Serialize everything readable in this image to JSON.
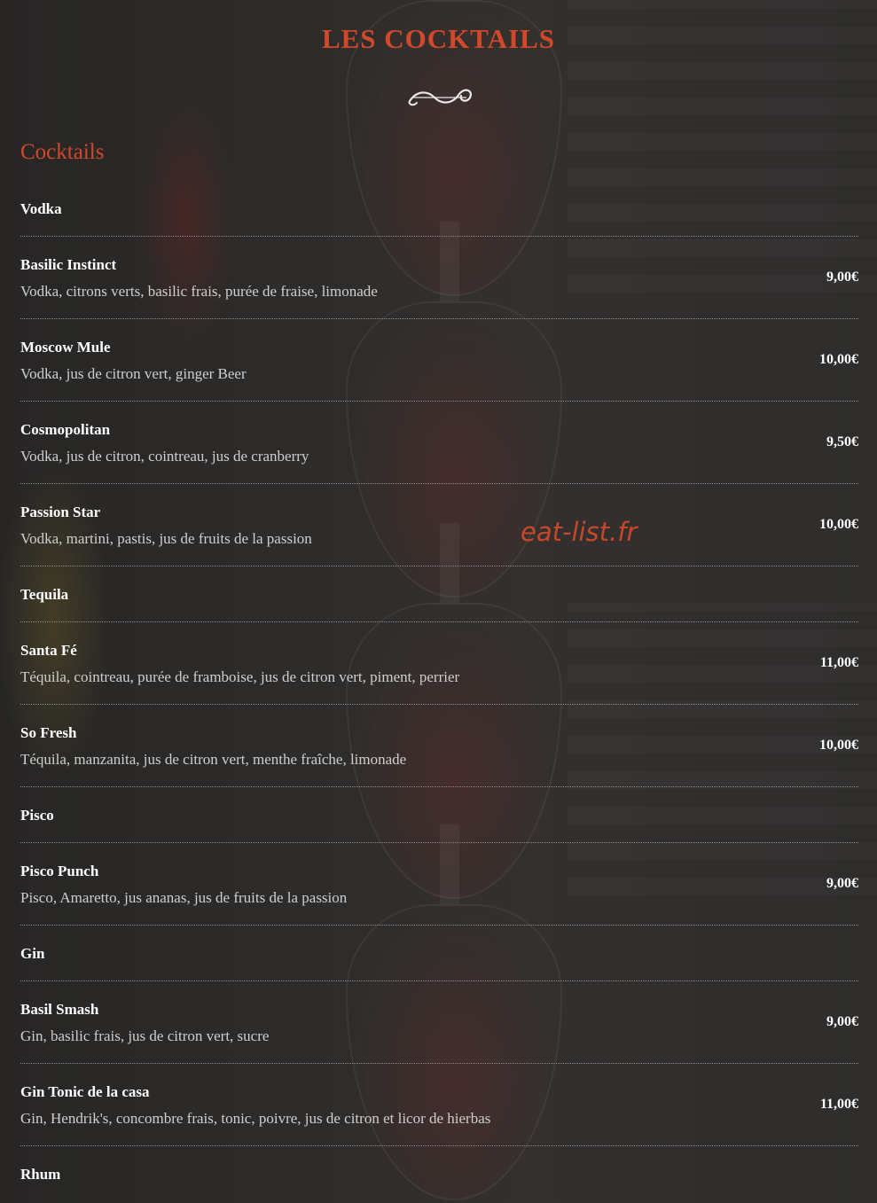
{
  "header": {
    "title": "LES COCKTAILS"
  },
  "section": {
    "title": "Cocktails"
  },
  "menu": [
    {
      "type": "category",
      "name": "Vodka"
    },
    {
      "type": "item",
      "name": "Basilic Instinct",
      "desc": "Vodka, citrons verts, basilic frais, purée de fraise, limonade",
      "price": "9,00€"
    },
    {
      "type": "item",
      "name": "Moscow Mule",
      "desc": "Vodka, jus de citron vert, ginger Beer",
      "price": "10,00€"
    },
    {
      "type": "item",
      "name": "Cosmopolitan",
      "desc": "Vodka, jus de citron, cointreau, jus de cranberry",
      "price": "9,50€"
    },
    {
      "type": "item",
      "name": "Passion Star",
      "desc": "Vodka, martini, pastis, jus de fruits de la passion",
      "price": "10,00€"
    },
    {
      "type": "category",
      "name": "Tequila"
    },
    {
      "type": "item",
      "name": "Santa Fé",
      "desc": "Téquila, cointreau, purée de framboise, jus de citron vert, piment, perrier",
      "price": "11,00€"
    },
    {
      "type": "item",
      "name": "So Fresh",
      "desc": "Téquila, manzanita, jus de citron vert, menthe fraîche, limonade",
      "price": "10,00€"
    },
    {
      "type": "category",
      "name": "Pisco"
    },
    {
      "type": "item",
      "name": "Pisco Punch",
      "desc": "Pisco, Amaretto, jus ananas, jus de fruits de la passion",
      "price": "9,00€"
    },
    {
      "type": "category",
      "name": "Gin"
    },
    {
      "type": "item",
      "name": "Basil Smash",
      "desc": "Gin, basilic frais, jus de citron vert, sucre",
      "price": "9,00€"
    },
    {
      "type": "item",
      "name": "Gin Tonic de la casa",
      "desc": "Gin, Hendrik's, concombre frais, tonic, poivre, jus de citron et licor de hierbas",
      "price": "11,00€"
    },
    {
      "type": "category",
      "name": "Rhum"
    }
  ],
  "watermark": "eat-list.fr",
  "colors": {
    "accent": "#d1492a",
    "background": "#2b2b2b",
    "text": "#ffffff",
    "description": "#cfcfcf"
  }
}
